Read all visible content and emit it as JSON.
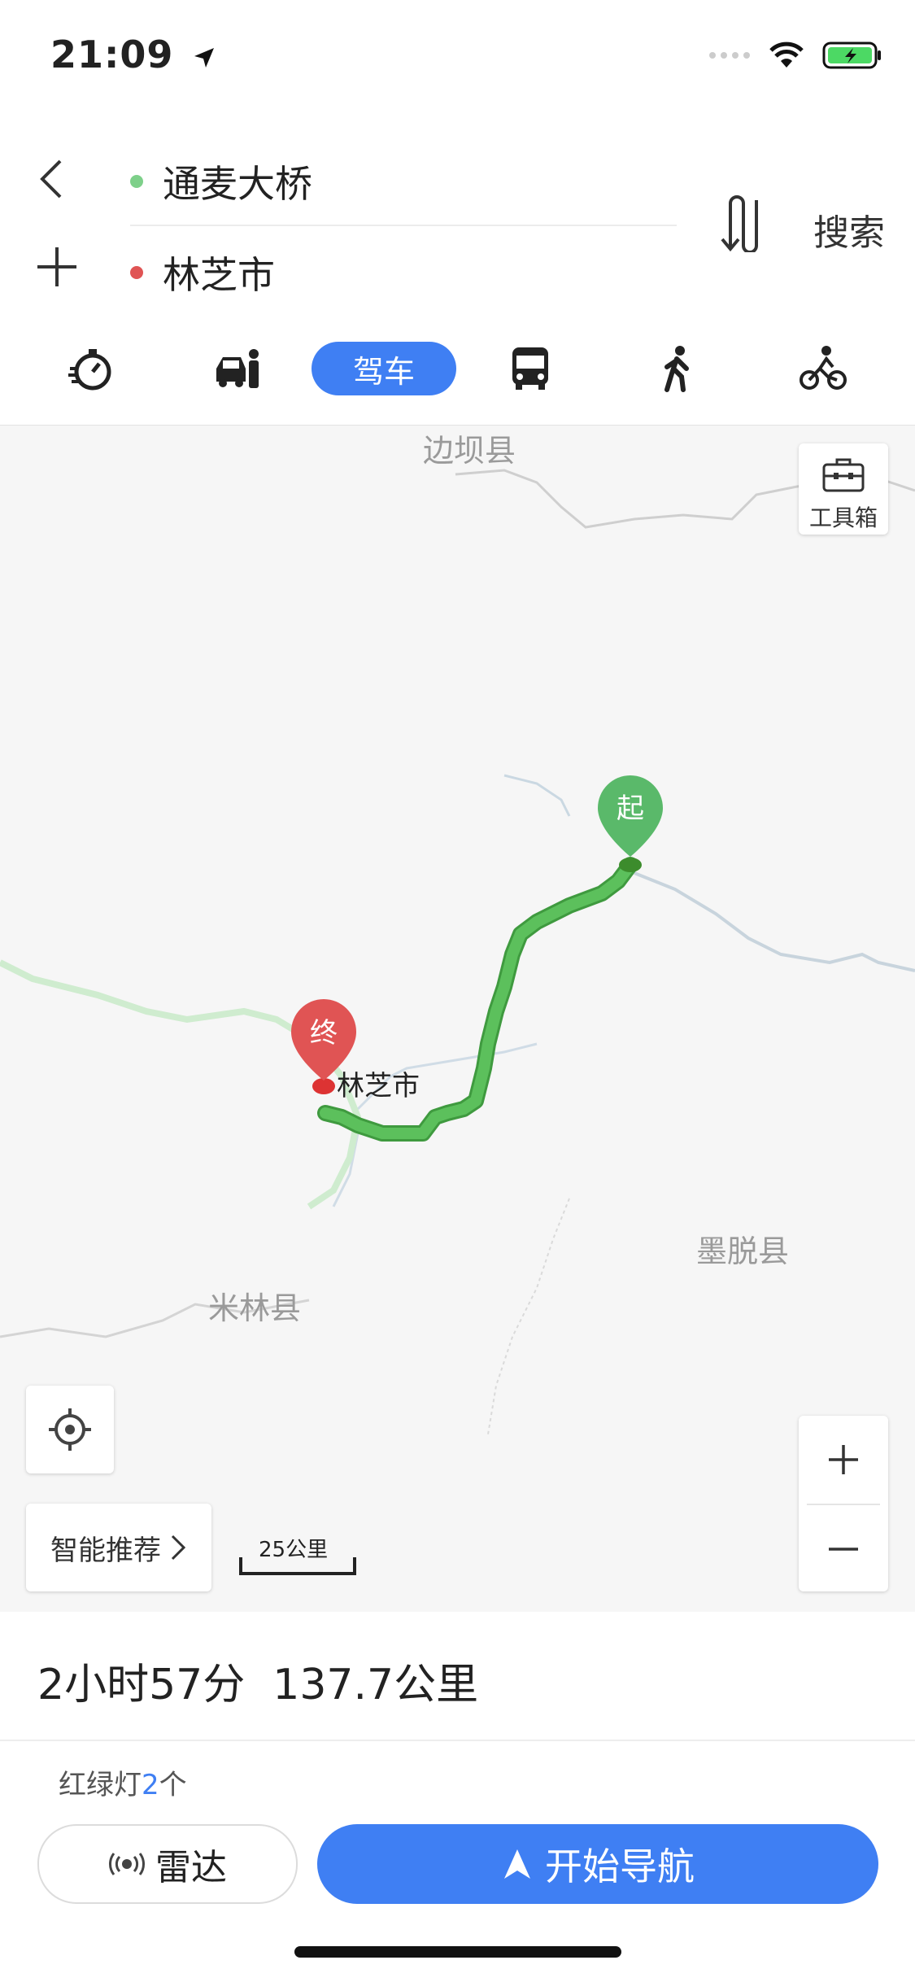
{
  "status": {
    "time": "21:09"
  },
  "route": {
    "origin": "通麦大桥",
    "destination": "林芝市",
    "search_label": "搜索"
  },
  "modes": {
    "active_label": "驾车",
    "items": [
      "timer-icon",
      "taxi-icon",
      "car",
      "bus-icon",
      "walk-icon",
      "bike-icon"
    ]
  },
  "map": {
    "labels": {
      "bianba": "边坝县",
      "medog": "墨脱县",
      "mainling": "米林县",
      "nyingchi": "林芝市"
    },
    "start_pin": "起",
    "end_pin": "终",
    "toolbox_label": "工具箱",
    "recommend_label": "智能推荐",
    "scale_label": "25公里"
  },
  "summary": {
    "duration": "2小时57分",
    "distance": "137.7公里"
  },
  "traffic_lights": {
    "prefix": "红绿灯",
    "count": "2",
    "suffix": "个"
  },
  "actions": {
    "radar_label": "雷达",
    "navigate_label": "开始导航"
  },
  "colors": {
    "accent": "#3f7ff3",
    "route": "#5cc05c",
    "origin_dot": "#7ed08a",
    "dest_dot": "#e05454"
  }
}
